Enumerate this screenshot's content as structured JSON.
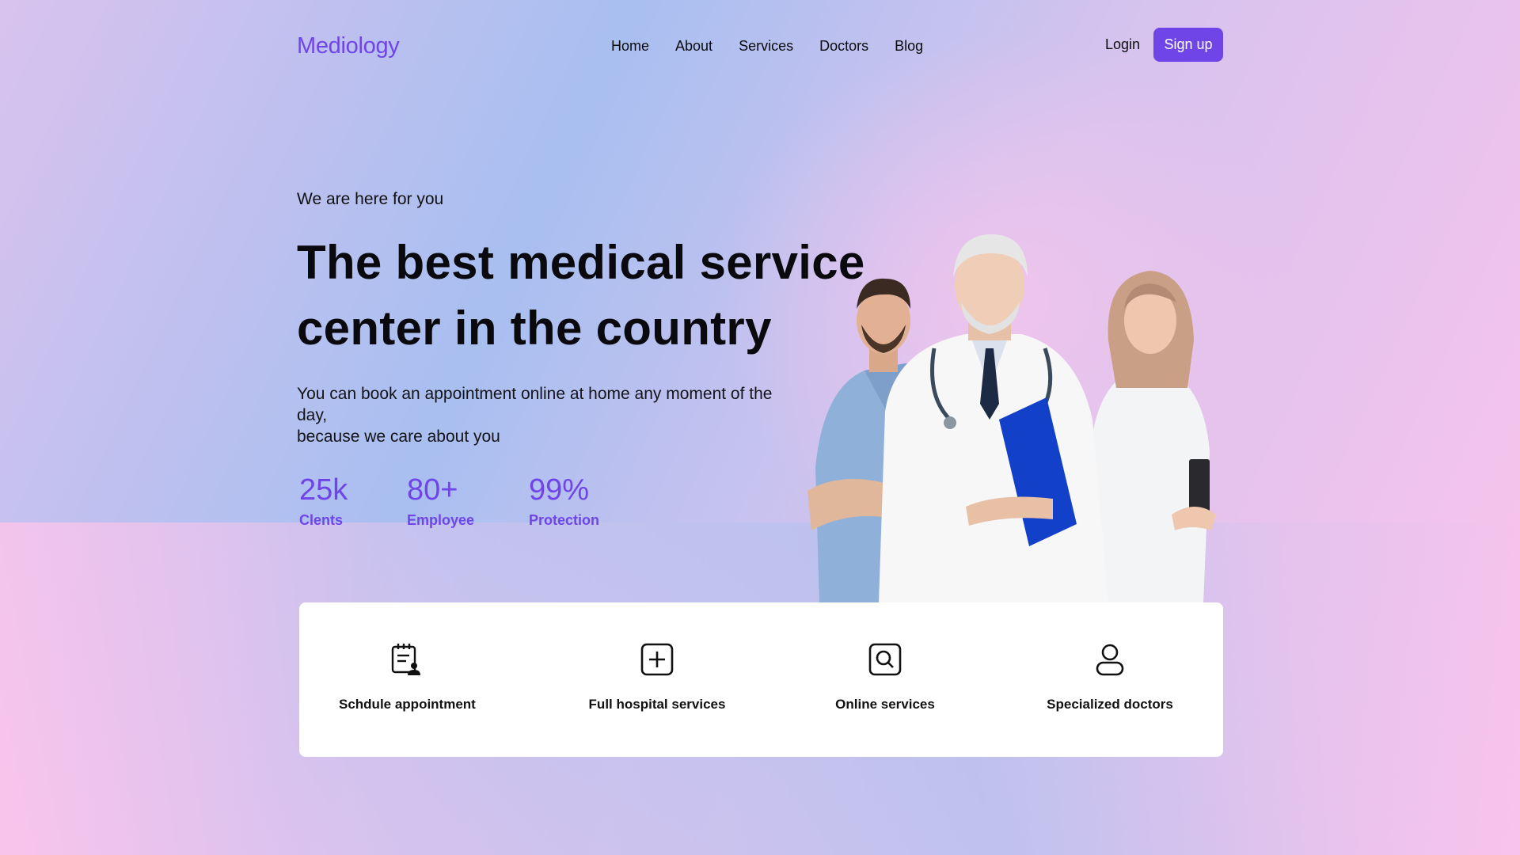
{
  "brand": {
    "name": "Mediology",
    "accent": "#6f45e8"
  },
  "nav": {
    "items": [
      {
        "label": "Home"
      },
      {
        "label": "About"
      },
      {
        "label": "Services"
      },
      {
        "label": "Doctors"
      },
      {
        "label": "Blog"
      }
    ],
    "login_label": "Login",
    "signup_label": "Sign up"
  },
  "hero": {
    "kicker": "We are here for you",
    "title_line1": "The best medical service",
    "title_line2": "center in the country",
    "subtitle_line1": "You can book an appointment online at home any moment of the day,",
    "subtitle_line2": "because we care about you"
  },
  "stats": [
    {
      "value": "25k",
      "label": "Clents"
    },
    {
      "value": "80+",
      "label": "Employee"
    },
    {
      "value": "99%",
      "label": "Protection"
    }
  ],
  "services": [
    {
      "label": "Schdule appointment",
      "icon": "calendar-user-icon"
    },
    {
      "label": "Full hospital services",
      "icon": "plus-square-icon"
    },
    {
      "label": "Online services",
      "icon": "search-square-icon"
    },
    {
      "label": "Specialized doctors",
      "icon": "user-icon"
    }
  ]
}
